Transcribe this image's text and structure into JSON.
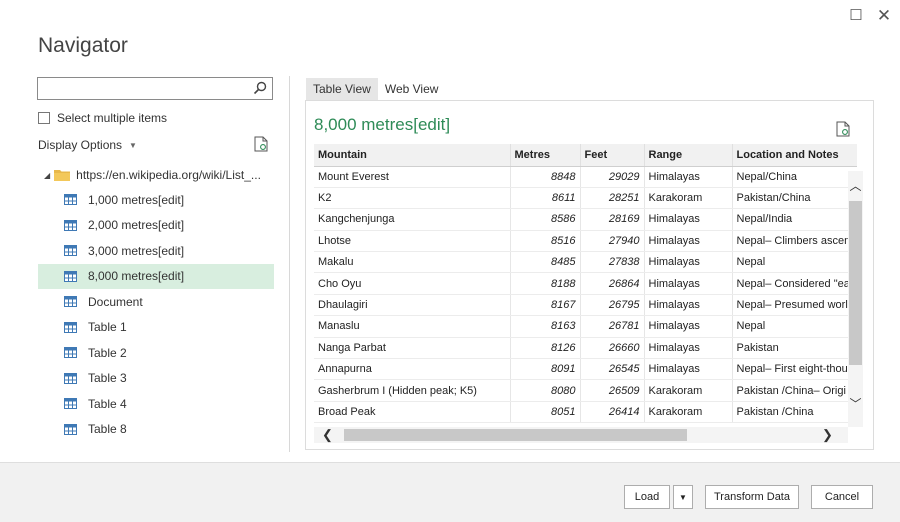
{
  "window": {
    "title": "Navigator",
    "maximize_glyph": "☐",
    "close_glyph": "✕"
  },
  "left": {
    "search": {
      "value": "",
      "placeholder": ""
    },
    "select_multiple_label": "Select multiple items",
    "select_multiple_checked": false,
    "display_options_label": "Display Options",
    "tree": {
      "root_label": "https://en.wikipedia.org/wiki/List_...",
      "items": [
        {
          "label": "1,000 metres[edit]",
          "selected": false
        },
        {
          "label": "2,000 metres[edit]",
          "selected": false
        },
        {
          "label": "3,000 metres[edit]",
          "selected": false
        },
        {
          "label": "8,000 metres[edit]",
          "selected": true
        },
        {
          "label": "Document",
          "selected": false
        },
        {
          "label": "Table 1",
          "selected": false
        },
        {
          "label": "Table 2",
          "selected": false
        },
        {
          "label": "Table 3",
          "selected": false
        },
        {
          "label": "Table 4",
          "selected": false
        },
        {
          "label": "Table 8",
          "selected": false
        }
      ]
    }
  },
  "right": {
    "tabs": [
      {
        "label": "Table View",
        "active": true
      },
      {
        "label": "Web View",
        "active": false
      }
    ],
    "preview_title": "8,000 metres[edit]",
    "table": {
      "columns": [
        "Mountain",
        "Metres",
        "Feet",
        "Range",
        "Location and Notes"
      ],
      "rows": [
        [
          "Mount Everest",
          "8848",
          "29029",
          "Himalayas",
          "Nepal/China"
        ],
        [
          "K2",
          "8611",
          "28251",
          "Karakoram",
          "Pakistan/China"
        ],
        [
          "Kangchenjunga",
          "8586",
          "28169",
          "Himalayas",
          "Nepal/India"
        ],
        [
          "Lhotse",
          "8516",
          "27940",
          "Himalayas",
          "Nepal– Climbers ascen"
        ],
        [
          "Makalu",
          "8485",
          "27838",
          "Himalayas",
          "Nepal"
        ],
        [
          "Cho Oyu",
          "8188",
          "26864",
          "Himalayas",
          "Nepal– Considered \"ea"
        ],
        [
          "Dhaulagiri",
          "8167",
          "26795",
          "Himalayas",
          "Nepal– Presumed worl"
        ],
        [
          "Manaslu",
          "8163",
          "26781",
          "Himalayas",
          "Nepal"
        ],
        [
          "Nanga Parbat",
          "8126",
          "26660",
          "Himalayas",
          "Pakistan"
        ],
        [
          "Annapurna",
          "8091",
          "26545",
          "Himalayas",
          "Nepal– First eight-thou"
        ],
        [
          "Gasherbrum I (Hidden peak; K5)",
          "8080",
          "26509",
          "Karakoram",
          "Pakistan /China– Origi"
        ],
        [
          "Broad Peak",
          "8051",
          "26414",
          "Karakoram",
          "Pakistan /China"
        ]
      ]
    }
  },
  "footer": {
    "load_label": "Load",
    "transform_label": "Transform Data",
    "cancel_label": "Cancel"
  },
  "colors": {
    "accent_green": "#2e8b57",
    "selected_row": "#d8eedf",
    "folder_yellow": "#e8b84a",
    "table_icon_blue": "#3f79b5"
  }
}
